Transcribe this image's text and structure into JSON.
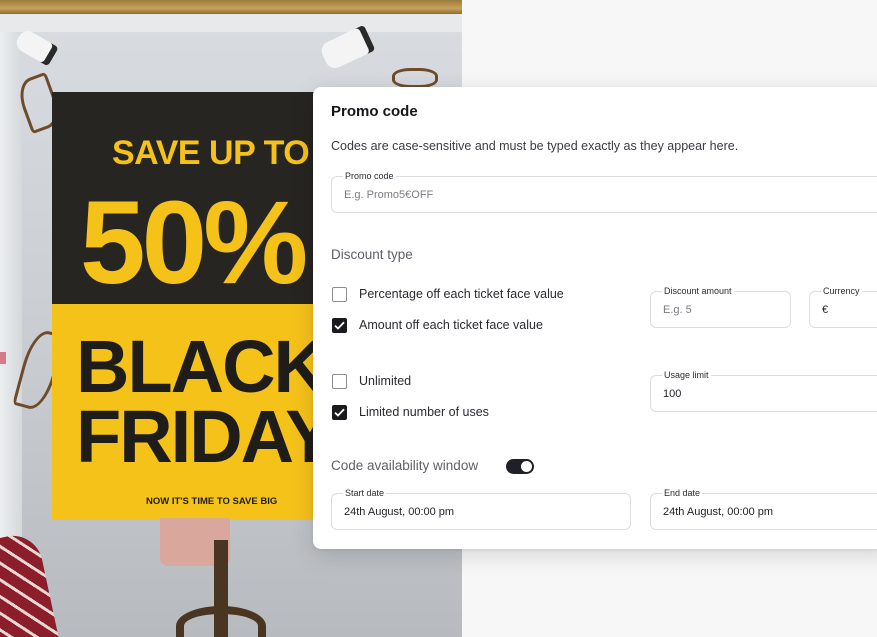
{
  "photo": {
    "poster_lines": [
      "SAVE UP TO",
      "50%",
      "BLACK",
      "FRIDAY",
      "NOW IT'S TIME TO SAVE BIG"
    ]
  },
  "card": {
    "title": "Promo code",
    "description": "Codes are case-sensitive and must be typed exactly as they appear here.",
    "promo_field": {
      "label": "Promo code",
      "value": "",
      "placeholder": "E.g. Promo5€OFF"
    },
    "discount_section_title": "Discount type",
    "discount_options": [
      {
        "label": "Percentage off each ticket face value",
        "checked": false
      },
      {
        "label": "Amount off each ticket face value",
        "checked": true
      }
    ],
    "discount_amount_field": {
      "label": "Discount amount",
      "value": "",
      "placeholder": "E.g. 5"
    },
    "currency_field": {
      "label": "Currency",
      "value": "€"
    },
    "usage_options": [
      {
        "label": "Unlimited",
        "checked": false
      },
      {
        "label": "Limited number of uses",
        "checked": true
      }
    ],
    "usage_limit_field": {
      "label": "Usage limit",
      "value": "100"
    },
    "availability_title": "Code availability window",
    "availability_toggle_on": true,
    "start_date_field": {
      "label": "Start date",
      "value": "24th August, 00:00 pm"
    },
    "end_date_field": {
      "label": "End date",
      "value": "24th August, 00:00 pm"
    }
  },
  "colors": {
    "page_bg": "#f7f7f8",
    "card_bg": "#ffffff",
    "checkbox_checked": "#1a1a1f",
    "toggle_on": "#1f2026",
    "poster_yellow": "#f5c21a",
    "poster_dark": "#262522"
  }
}
